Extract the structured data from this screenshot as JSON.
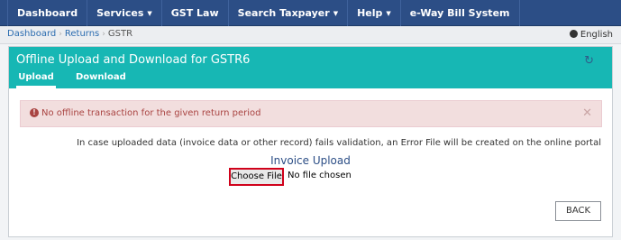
{
  "nav": {
    "items": [
      {
        "label": "Dashboard",
        "dropdown": false
      },
      {
        "label": "Services",
        "dropdown": true
      },
      {
        "label": "GST Law",
        "dropdown": false
      },
      {
        "label": "Search Taxpayer",
        "dropdown": true
      },
      {
        "label": "Help",
        "dropdown": true
      },
      {
        "label": "e-Way Bill System",
        "dropdown": false
      }
    ],
    "caret": "▼"
  },
  "breadcrumb": {
    "items": [
      "Dashboard",
      "Returns",
      "GSTR"
    ],
    "separator": "›"
  },
  "language": {
    "label": "English",
    "icon": "globe-icon"
  },
  "card": {
    "title": "Offline Upload and Download for GSTR6",
    "refresh_icon": "↻",
    "tabs": [
      {
        "label": "Upload",
        "active": true
      },
      {
        "label": "Download",
        "active": false
      }
    ]
  },
  "alert": {
    "icon": "!",
    "message": "No offline transaction for the given return period",
    "close": "✕"
  },
  "info_text": "In case uploaded data (invoice data or other record) fails validation, an Error File will be created on the online portal",
  "upload": {
    "title": "Invoice Upload",
    "choose_file_label": "Choose File",
    "no_file_text": "No file chosen"
  },
  "back_label": "BACK",
  "colors": {
    "nav_bg": "#2c4e86",
    "header_teal": "#17b7b4",
    "alert_bg": "#f2dede",
    "alert_text": "#a94442",
    "highlight_red": "#d0021b"
  }
}
